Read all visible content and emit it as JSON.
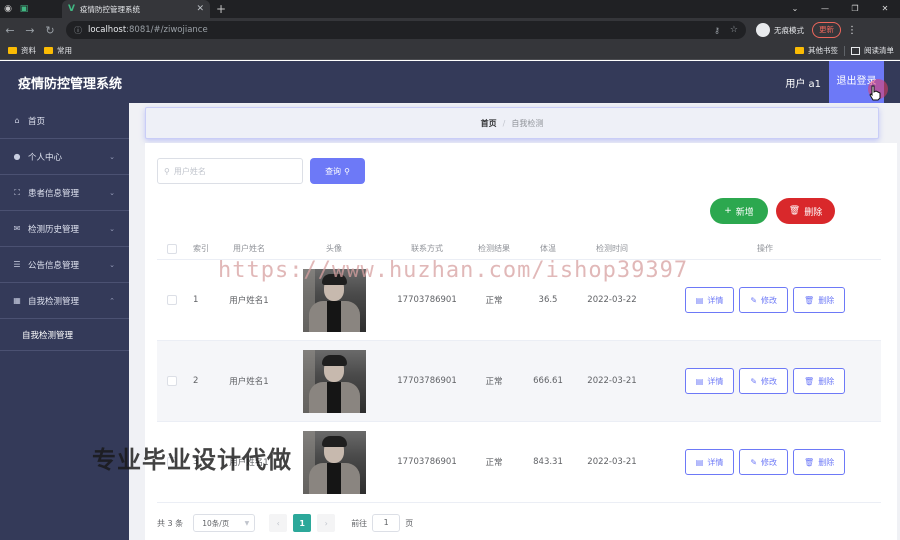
{
  "browser": {
    "tab_title": "疫情防控管理系统",
    "url_host": "localhost",
    "url_path": ":8081/#/ziwojiance",
    "incognito_label": "无痕模式",
    "update_label": "更新",
    "bookmarks": [
      "资料",
      "常用"
    ],
    "bookmarks_right": [
      "其他书签",
      "阅读清单"
    ]
  },
  "header": {
    "title": "疫情防控管理系统",
    "user": "用户 a1",
    "logout": "退出登录"
  },
  "sidebar": {
    "items": [
      {
        "label": "首页",
        "icon": "home-icon"
      },
      {
        "label": "个人中心",
        "icon": "user-icon"
      },
      {
        "label": "患者信息管理",
        "icon": "scan-icon"
      },
      {
        "label": "检测历史管理",
        "icon": "mail-icon"
      },
      {
        "label": "公告信息管理",
        "icon": "list-icon"
      },
      {
        "label": "自我检测管理",
        "icon": "grid-icon"
      }
    ],
    "sub_item": "自我检测管理"
  },
  "breadcrumb": {
    "home": "首页",
    "separator": "/",
    "current": "自我检测"
  },
  "search": {
    "placeholder": "用户姓名",
    "button": "查询"
  },
  "actions": {
    "add": "新增",
    "delete": "删除"
  },
  "table": {
    "columns": [
      "索引",
      "用户姓名",
      "头像",
      "联系方式",
      "检测结果",
      "体温",
      "检测时间",
      "操作"
    ],
    "rows": [
      {
        "index": "1",
        "name": "用户姓名1",
        "phone": "17703786901",
        "result": "正常",
        "temp": "36.5",
        "time": "2022-03-22"
      },
      {
        "index": "2",
        "name": "用户姓名1",
        "phone": "17703786901",
        "result": "正常",
        "temp": "666.61",
        "time": "2022-03-21"
      },
      {
        "index": "3",
        "name": "用户姓名1",
        "phone": "17703786901",
        "result": "正常",
        "temp": "843.31",
        "time": "2022-03-21"
      }
    ],
    "ops": {
      "detail": "详情",
      "edit": "修改",
      "delete": "删除"
    }
  },
  "pagination": {
    "total": "共 3 条",
    "page_size": "10条/页",
    "current_page": "1",
    "goto_label": "前往",
    "goto_value": "1",
    "page_suffix": "页"
  },
  "watermarks": {
    "url": "https://www.huzhan.com/ishop39397",
    "text": "专业毕业设计代做"
  },
  "colors": {
    "sidebar": "#343a59",
    "primary": "#6d79f7",
    "success": "#2ca84f",
    "danger": "#d9282b"
  }
}
